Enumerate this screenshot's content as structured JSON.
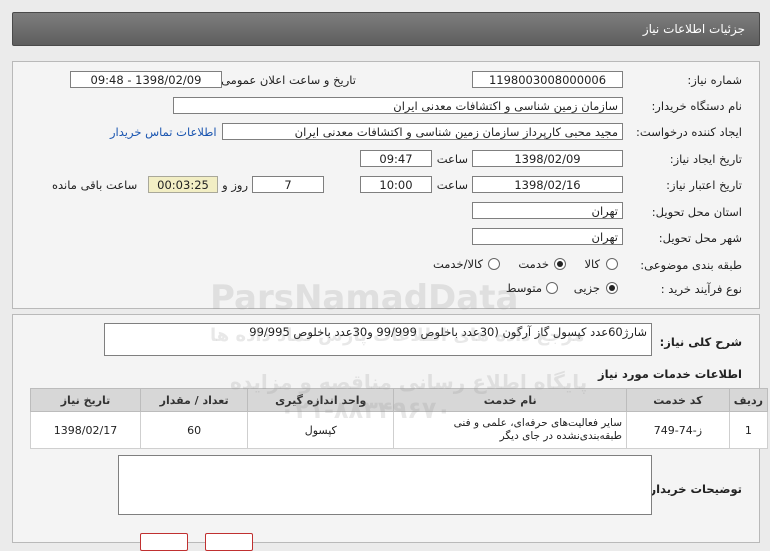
{
  "header": {
    "title": "جزئیات اطلاعات نیاز"
  },
  "form": {
    "need_number_label": "شماره نیاز:",
    "need_number": "1198003008000006",
    "announce_label": "تاریخ و ساعت اعلان عمومی:",
    "announce_value": "1398/02/09 - 09:48",
    "buyer_org_label": "نام دستگاه خریدار:",
    "buyer_org": "سازمان زمین شناسی و اکتشافات معدنی ایران",
    "requester_label": "ایجاد کننده درخواست:",
    "requester": "مجید محبی کارپرداز سازمان زمین شناسی و اکتشافات معدنی ایران",
    "contact_link": "اطلاعات تماس خریدار",
    "created_label": "تاریخ ایجاد نیاز:",
    "created_date": "1398/02/09",
    "created_time_label": "ساعت",
    "created_time": "09:47",
    "valid_label": "تاریخ اعتبار نیاز:",
    "valid_date": "1398/02/16",
    "valid_time_label": "ساعت",
    "valid_time": "10:00",
    "days_value": "7",
    "days_label": "روز و",
    "remaining_time": "00:03:25",
    "remaining_label": "ساعت باقی مانده",
    "province_label": "استان محل تحویل:",
    "province": "تهران",
    "city_label": "شهر محل تحویل:",
    "city": "تهران",
    "category_label": "طبقه بندی موضوعی:",
    "category_options": [
      "کالا",
      "خدمت",
      "کالا/خدمت"
    ],
    "category_selected": "خدمت",
    "process_label": "نوع فرآیند خرید :",
    "process_options": [
      "جزیی",
      "متوسط"
    ],
    "process_selected": "جزیی"
  },
  "description": {
    "label": "شرح کلی نیاز:",
    "text": "شارژ60عدد کپسول گاز آرگون (30عدد باخلوص 99/999 و30عدد باخلوص 99/995"
  },
  "services": {
    "title": "اطلاعات خدمات مورد نیاز",
    "headers": [
      "ردیف",
      "کد خدمت",
      "نام خدمت",
      "واحد اندازه گیری",
      "تعداد / مقدار",
      "تاریخ نیاز"
    ],
    "rows": [
      [
        "1",
        "ز-74-749",
        "سایر فعالیت‌های حرفه‌ای، علمی و فنی طبقه‌بندی‌نشده در جای دیگر",
        "کپسول",
        "60",
        "1398/02/17"
      ]
    ]
  },
  "buyer_notes": {
    "label": "توضیحات خریدار:",
    "text": ""
  },
  "watermark": {
    "line1": "ParsNamadData",
    "line2": "مرجع داده های اطلاعات پارس نماد داده ها",
    "line3": "پایگاه اطلاع رسانی مناقصه و مزایده",
    "line4": "۰۲۱-۸۸۳۴۹۶۷۰"
  }
}
